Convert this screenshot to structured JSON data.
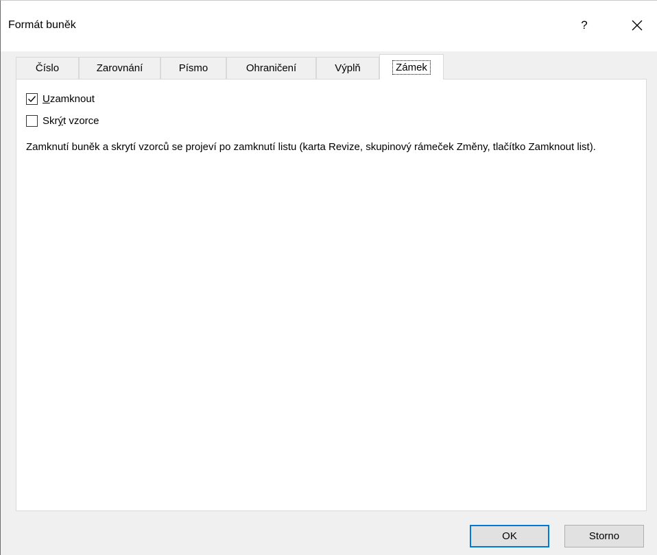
{
  "window": {
    "title": "Formát buněk",
    "help_label": "?",
    "close_icon": "close-icon"
  },
  "tabs": [
    {
      "label": "Číslo",
      "active": false
    },
    {
      "label": "Zarovnání",
      "active": false
    },
    {
      "label": "Písmo",
      "active": false
    },
    {
      "label": "Ohraničení",
      "active": false
    },
    {
      "label": "Výplň",
      "active": false
    },
    {
      "label": "Zámek",
      "active": true
    }
  ],
  "protection": {
    "lock": {
      "accel": "U",
      "rest": "zamknout",
      "checked": true
    },
    "hide": {
      "before": "Skr",
      "accel": "ý",
      "after": "t vzorce",
      "checked": false
    },
    "description": "Zamknutí buněk a skrytí vzorců se projeví po zamknutí listu (karta Revize, skupinový rámeček Změny, tlačítko Zamknout list)."
  },
  "buttons": {
    "ok_label": "OK",
    "cancel_label": "Storno"
  },
  "colors": {
    "default_button_border": "#0078d7",
    "panel_background": "#ffffff",
    "dialog_background": "#f0f0f0"
  }
}
